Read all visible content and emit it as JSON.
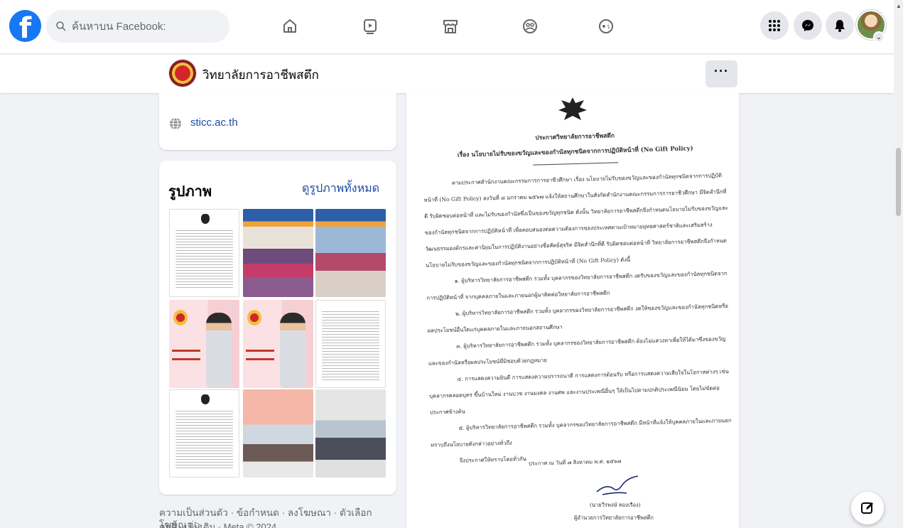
{
  "nav": {
    "logo_letter": "f",
    "search_placeholder": "ค้นหาบน Facebook:",
    "icons": [
      "home-icon",
      "watch-icon",
      "marketplace-icon",
      "groups-icon",
      "gaming-icon"
    ],
    "right_icons": [
      "menu-grid-icon",
      "messenger-icon",
      "notifications-icon"
    ],
    "brand_color": "#1877f2"
  },
  "page": {
    "name": "วิทยาลัยการอาชีพสตึก",
    "more_label": "···"
  },
  "intro": {
    "website": "sticc.ac.th"
  },
  "photos": {
    "title": "รูปภาพ",
    "see_all": "ดูรูปภาพทั้งหมด"
  },
  "footer": {
    "line1": "ความเป็นส่วนตัว · ข้อกำหนด · ลงโฆษณา · ตัวเลือกโฆษณา ▷ ·",
    "line2": "คุกกี้ · เพิ่มเติม · Meta © 2024"
  },
  "document": {
    "heading1": "ประกาศวิทยาลัยการอาชีพสตึก",
    "heading2": "เรื่อง นโยบายไม่รับของขวัญและของกำนัลทุกชนิดจากการปฏิบัติหน้าที่ (No Gift Policy)",
    "paragraphs": [
      "ตามประกาศสำนักงานคณะกรรมการการอาชีวศึกษา เรื่อง นโยบายไม่รับของขวัญและของกำนัลทุกชนิดจากการปฏิบัติหน้าที่ (No Gift Policy) ลงวันที่ ๘ มกราคม ๒๕๖๗ แจ้งให้สถานศึกษาในสังกัดสำนักงานคณะกรรมการการอาชีวศึกษา มีจิตสำนึกที่ดี รับผิดชอบต่อหน้าที่ และไม่รับของกำนัลซึ่งเป็นของขวัญทุกชนิด ดังนั้น วิทยาลัยการอาชีพสตึกจึงกำหนดนโยบายไม่รับของขวัญและของกำนัลทุกชนิดจากการปฏิบัติหน้าที่ เพื่อตอบสนองต่อความต้องการของประเทศตามเป้าหมายยุทธศาสตร์ชาติและเสริมสร้างวัฒนธรรมองค์กรและค่านิยมในการปฏิบัติงานอย่างซื่อสัตย์สุจริต มีจิตสำนึกที่ดี รับผิดชอบต่อหน้าที่ วิทยาลัยการอาชีพสตึกจึงกำหนดนโยบายไม่รับของขวัญและของกำนัลทุกชนิดจากการปฏิบัติหน้าที่ (No Gift Policy) ดังนี้",
      "๑. ผู้บริหารวิทยาลัยการอาชีพสตึก รวมทั้ง บุคลากรของวิทยาลัยการอาชีพสตึก งดรับของขวัญและของกำนัลทุกชนิดจากการปฏิบัติหน้าที่ จากบุคคลภายในและภายนอกผู้มาติดต่อวิทยาลัยการอาชีพสตึก",
      "๒. ผู้บริหารวิทยาลัยการอาชีพสตึก รวมทั้ง บุคลากรของวิทยาลัยการอาชีพสตึก งดให้ของขวัญและของกำนัลทุกชนิดหรือผลประโยชน์อื่นใดแก่บุคคลภายในและภายนอกสถานศึกษา",
      "๓. ผู้บริหารวิทยาลัยการอาชีพสตึก รวมทั้ง บุคลากรของวิทยาลัยการอาชีพสตึก ต้องไม่แสวงหาเพื่อให้ได้มาซึ่งของขวัญและของกำนัลหรือผลประโยชน์ที่มิชอบด้วยกฎหมาย",
      "๔. การแสดงความยินดี การแสดงความปรารถนาดี การแสดงการต้อนรับ หรือการแสดงความเสียใจในโอกาสต่างๆ เช่น บุคลากรคลอดบุตร ขึ้นบ้านใหม่ งานบวช งานมงคล งานศพ และงานประเพณีอื่นๆ ให้เป็นไปตามปกติประเพณีนิยม โดยไม่ขัดต่อประกาศข้างต้น",
      "๕. ผู้บริหารวิทยาลัยการอาชีพสตึก รวมทั้ง บุคลากรของวิทยาลัยการอาชีพสตึก มีหน้าที่แจ้งให้บุคคลภายในและภายนอกทราบถึงนโยบายดังกล่าวอย่างทั่วถึง",
      "จึงประกาศให้ทราบโดยทั่วกัน"
    ],
    "date_line": "ประกาศ ณ วันที่ ๗ สิงหาคม พ.ศ. ๒๕๖๗",
    "signer_name": "(นายวีรพงษ์ ทองเรือง)",
    "signer_title": "ผู้อำนวยการวิทยาลัยการอาชีพสตึก"
  }
}
